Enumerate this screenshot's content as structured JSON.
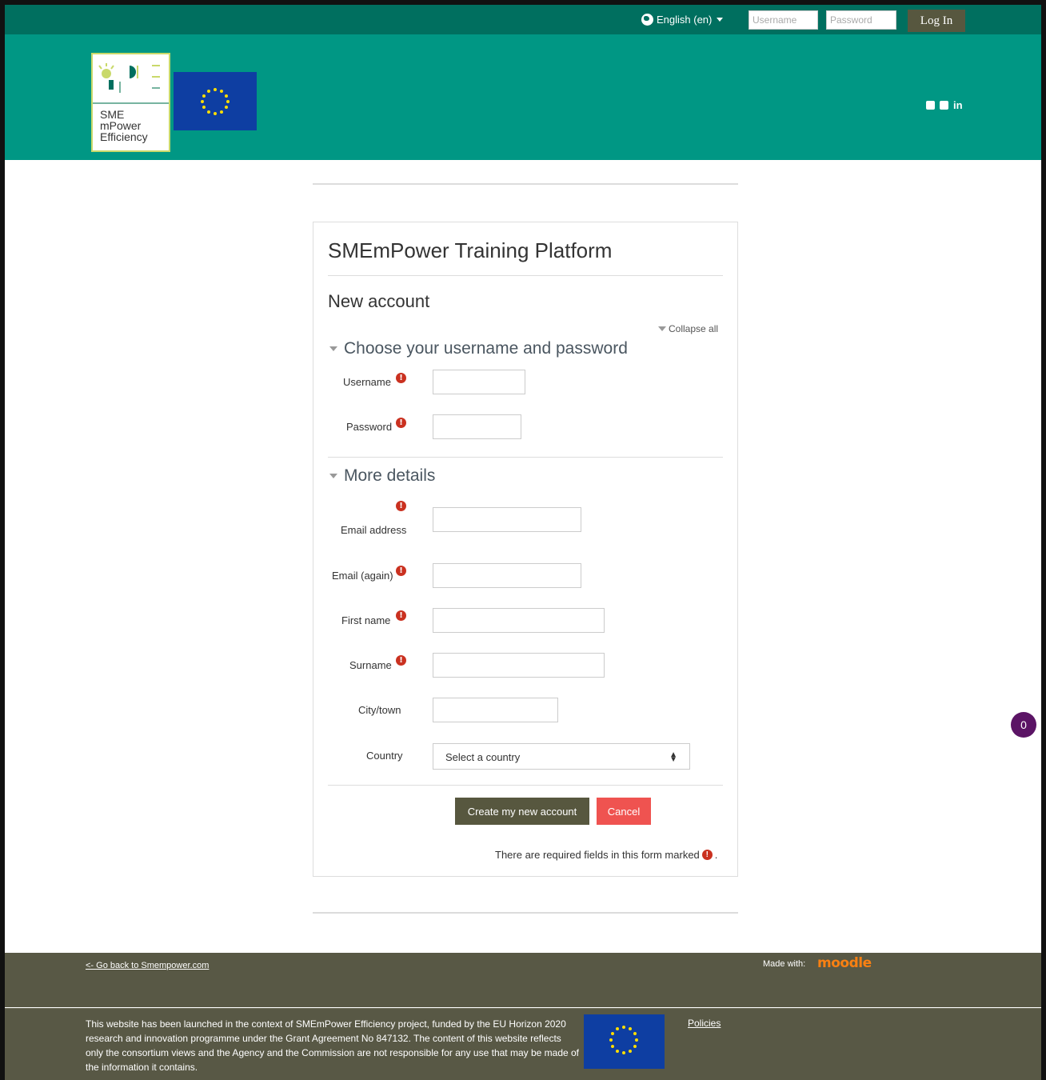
{
  "topbar": {
    "language": "English (en)",
    "username_placeholder": "Username",
    "password_placeholder": "Password",
    "login_label": "Log In"
  },
  "logo": {
    "line1": "SME",
    "line2": "mPower",
    "line3": "Efficiency"
  },
  "social": {
    "linkedin": "in"
  },
  "page": {
    "site_title": "SMEmPower Training Platform",
    "heading": "New account",
    "collapse_all": "Collapse all"
  },
  "sections": {
    "credentials": "Choose your username and password",
    "details": "More details"
  },
  "fields": {
    "username": "Username",
    "password": "Password",
    "email": "Email address",
    "email_again": "Email (again)",
    "first_name": "First name",
    "surname": "Surname",
    "city": "City/town",
    "country": "Country",
    "country_selected": "Select a country"
  },
  "required_icon": "!",
  "buttons": {
    "create": "Create my new account",
    "cancel": "Cancel"
  },
  "required_note": "There are required fields in this form marked",
  "required_note_end": ".",
  "message_count": "0",
  "footer": {
    "back_link": "<- Go back to Smempower.com",
    "made_with": "Made with:",
    "moodle": "moodle",
    "disclaimer": "This website has been launched in the context of SMEmPower Efficiency project, funded by the EU Horizon 2020 research and innovation programme under the Grant Agreement No 847132. The content of this website reflects only the consortium views and the Agency and the Commission are not responsible for any use that may be made of the information it contains.",
    "policies": "Policies"
  },
  "colors": {
    "topbar": "#006f5f",
    "header": "#009784",
    "footer": "#585845",
    "button_dark": "#57573f",
    "cancel": "#ef5350",
    "required": "#ca3120",
    "message_badge": "#5b1465",
    "eu_blue": "#0e3ea2"
  }
}
